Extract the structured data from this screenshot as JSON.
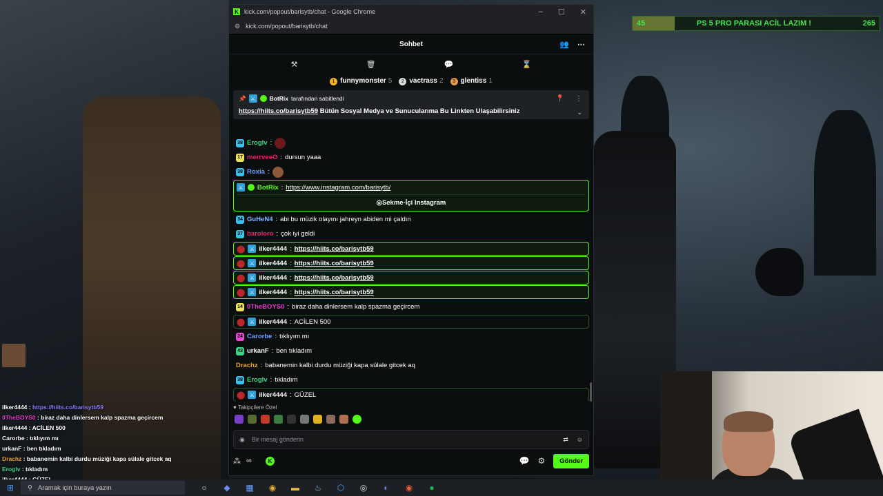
{
  "goal": {
    "current": "45",
    "title": "PS 5 PRO PARASI ACİL LAZIM !",
    "target": "265",
    "progress": 0.17
  },
  "window": {
    "title": "kick.com/popout/barisytb/chat - Google Chrome",
    "url": "kick.com/popout/barisytb/chat",
    "controls": [
      "–",
      "☐",
      "✕"
    ]
  },
  "chat": {
    "title": "Sohbet",
    "gifters": [
      {
        "rank": "1",
        "name": "funnymonster",
        "count": "5",
        "color": "#f0b429"
      },
      {
        "rank": "2",
        "name": "vactrass",
        "count": "2",
        "color": "#dcdcdc"
      },
      {
        "rank": "3",
        "name": "glentiss",
        "count": "1",
        "color": "#e09a4a"
      }
    ],
    "pinned": {
      "by_user": "BotRix",
      "by_text": "tarafından sabitlendi",
      "link": "https://hiits.co/barisytb59",
      "text": "Bütün Sosyal Medya ve Sunucularıma Bu Linkten Ulaşabilirsiniz"
    },
    "messages": [
      {
        "sub": "38",
        "sub_color": "#39c2f0",
        "user": "Eroglv",
        "user_color": "#39d88a",
        "text": "",
        "emote": "#6b1a1a"
      },
      {
        "sub": "17",
        "sub_color": "#f1e35a",
        "user": "merrveeO",
        "user_color": "#e0266e",
        "text": "dursun yaaa"
      },
      {
        "sub": "38",
        "sub_color": "#39c2f0",
        "user": "Roxia",
        "user_color": "#6ea0ff",
        "text": "",
        "emote": "#8a5a3a"
      },
      {
        "sub": "34",
        "sub_color": "#39c2f0",
        "user": "GuHeN4",
        "user_color": "#7ab8ff",
        "text": "abi bu müzik olayını jahreyn abiden mi çaldın"
      },
      {
        "sub": "37",
        "sub_color": "#39c2f0",
        "user": "baroloro",
        "user_color": "#e0266e",
        "text": "çok iyi geldi"
      },
      {
        "user": "ilker4444",
        "user_color": "#ffffff",
        "link": "https://hiits.co/barisytb59",
        "style": "hl"
      },
      {
        "user": "ilker4444",
        "user_color": "#ffffff",
        "link": "https://hiits.co/barisytb59",
        "style": "hl"
      },
      {
        "user": "ilker4444",
        "user_color": "#ffffff",
        "link": "https://hiits.co/barisytb59",
        "style": "hl"
      },
      {
        "user": "ilker4444",
        "user_color": "#ffffff",
        "link": "https://hiits.co/barisytb59",
        "style": "hl"
      },
      {
        "sub": "14",
        "sub_color": "#f1e35a",
        "user": "0TheBOYS0",
        "user_color": "#e63cc8",
        "text": "biraz daha dinlersem kalp spazma geçircem"
      },
      {
        "user": "ilker4444",
        "user_color": "#ffffff",
        "text": "ACİLEN 500",
        "style": "hl2"
      },
      {
        "sub": "24",
        "sub_color": "#e84ad6",
        "user": "Carorbe",
        "user_color": "#6ea0ff",
        "text": "tıklıyım mı"
      },
      {
        "sub": "43",
        "sub_color": "#39d88a",
        "user": "urkanF",
        "user_color": "#ffffff",
        "text": "ben tıkladım"
      },
      {
        "user": "Drachz",
        "user_color": "#f0a030",
        "text": "babanemin kalbi durdu müziği kapa sülale gitcek aq"
      },
      {
        "sub": "38",
        "sub_color": "#39c2f0",
        "user": "Eroglv",
        "user_color": "#39d88a",
        "text": "tıkladım"
      },
      {
        "user": "ilker4444",
        "user_color": "#ffffff",
        "text": "GÜZEL",
        "style": "hl2"
      }
    ],
    "bot_message": {
      "user": "BotRix",
      "link": "https://www.instagram.com/barisytb/",
      "command": "Sekme-İçi Instagram"
    },
    "emote_label": "Takipçilere Özel",
    "input_placeholder": "Bir mesaj gönderin",
    "send_label": "Gönder"
  },
  "overlay_chat": [
    {
      "user": "ilker4444",
      "text": "https://hiits.co/barisytb59",
      "link": true
    },
    {
      "user": "0TheBOYS0",
      "text": "biraz daha dinlersem kalp spazma geçircem"
    },
    {
      "user": "ilker4444",
      "text": "ACİLEN 500"
    },
    {
      "user": "Carorbe",
      "text": "tıklıyım mı"
    },
    {
      "user": "urkanF",
      "text": "ben tıkladım"
    },
    {
      "user": "Drachz",
      "text": "babanemin kalbi durdu müziği kapa sülale gitcek aq"
    },
    {
      "user": "Eroglv",
      "text": "tıkladım"
    },
    {
      "user": "ilker4444",
      "text": "GÜZEL"
    }
  ],
  "taskbar": {
    "search_placeholder": "Aramak için buraya yazın"
  },
  "colors": {
    "kick_green": "#53fc18",
    "panel": "#0b0e0f"
  }
}
